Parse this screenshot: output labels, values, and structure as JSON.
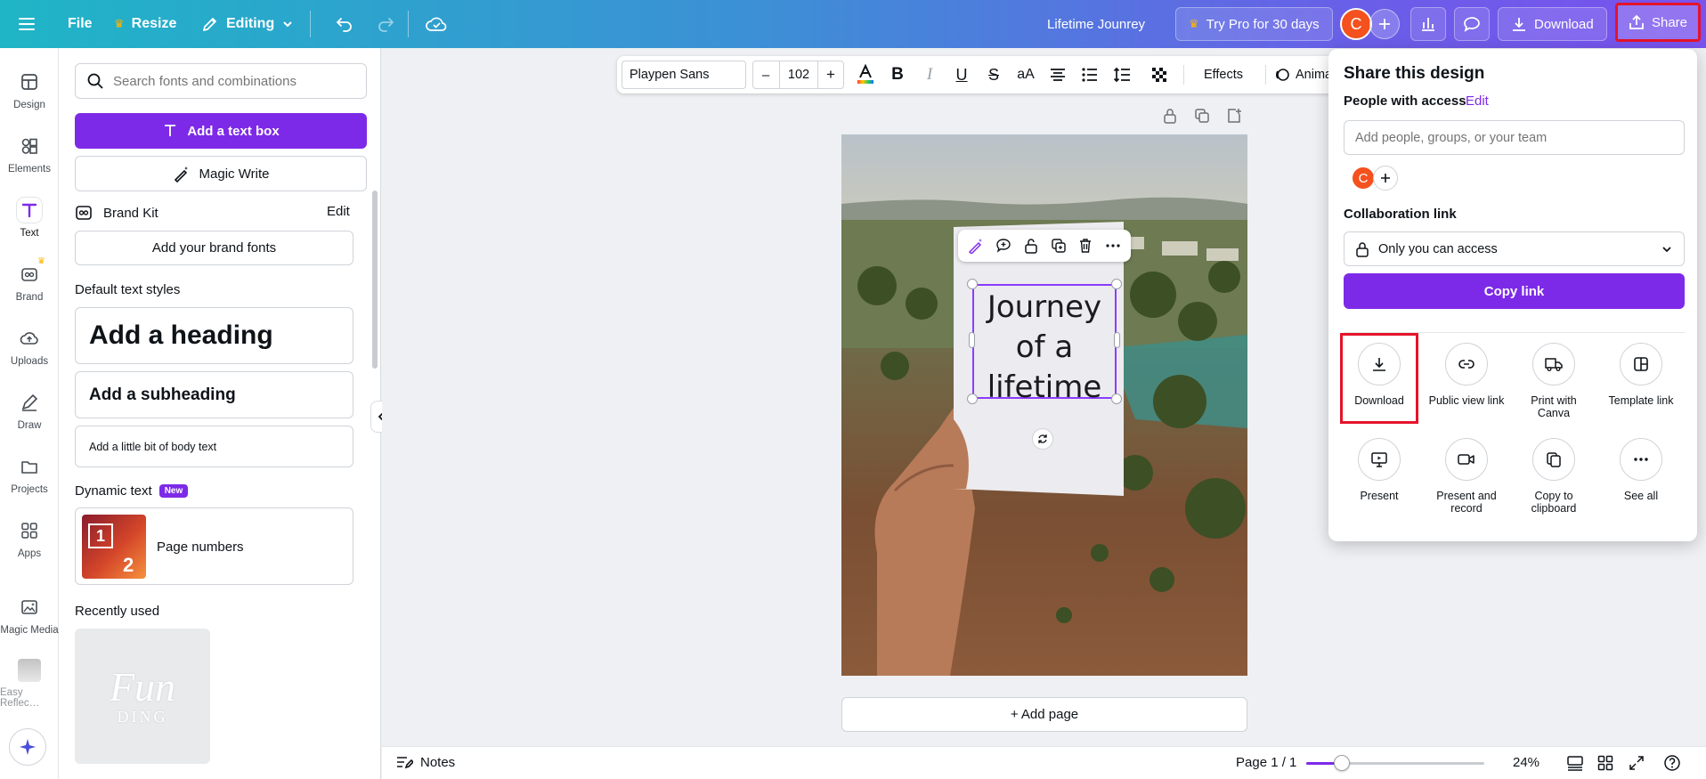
{
  "topbar": {
    "file_label": "File",
    "resize_label": "Resize",
    "editing_label": "Editing",
    "design_title": "Lifetime Jounrey",
    "try_pro_label": "Try Pro for 30 days",
    "avatar_letter": "C",
    "download_label": "Download",
    "share_label": "Share"
  },
  "rail": {
    "items": [
      {
        "label": "Design",
        "icon": "layout-icon"
      },
      {
        "label": "Elements",
        "icon": "shapes-icon"
      },
      {
        "label": "Text",
        "icon": "text-icon"
      },
      {
        "label": "Brand",
        "icon": "brand-icon"
      },
      {
        "label": "Uploads",
        "icon": "cloud-upload-icon"
      },
      {
        "label": "Draw",
        "icon": "pen-icon"
      },
      {
        "label": "Projects",
        "icon": "folder-icon"
      },
      {
        "label": "Apps",
        "icon": "apps-icon"
      },
      {
        "label": "Magic Media",
        "icon": "magic-media-icon"
      },
      {
        "label": "Easy Reflec…",
        "icon": "easy-reflection-icon"
      }
    ]
  },
  "panel": {
    "search_placeholder": "Search fonts and combinations",
    "add_text_box": "Add a text box",
    "magic_write": "Magic Write",
    "brand_kit": "Brand Kit",
    "brand_edit": "Edit",
    "add_brand_fonts": "Add your brand fonts",
    "default_styles": "Default text styles",
    "heading": "Add a heading",
    "subheading": "Add a subheading",
    "body": "Add a little bit of body text",
    "dynamic_text": "Dynamic text",
    "new_badge": "New",
    "page_numbers": "Page numbers",
    "page_num_thumb_1": "1",
    "page_num_thumb_2": "2",
    "recently_used": "Recently used",
    "recent_thumb_text_1": "Fun",
    "recent_thumb_text_2": "DING"
  },
  "toolbar": {
    "font": "Playpen Sans",
    "minus": "–",
    "font_size": "102",
    "plus": "+",
    "effects": "Effects",
    "animate": "Animate"
  },
  "canvas": {
    "text_line1": "Journey",
    "text_line2": "of a",
    "text_line3": "lifetime",
    "add_page": "+ Add page"
  },
  "share": {
    "title": "Share this design",
    "people_with_access": "People with access",
    "edit": "Edit",
    "add_people_placeholder": "Add people, groups, or your team",
    "avatar_letter": "C",
    "collab_link": "Collaboration link",
    "access_value": "Only you can access",
    "copy_link": "Copy link",
    "options": [
      {
        "label": "Download",
        "icon": "download-icon"
      },
      {
        "label": "Public view link",
        "icon": "link-icon"
      },
      {
        "label": "Print with Canva",
        "icon": "truck-icon"
      },
      {
        "label": "Template link",
        "icon": "template-icon"
      },
      {
        "label": "Present",
        "icon": "present-icon"
      },
      {
        "label": "Present and record",
        "icon": "camera-icon"
      },
      {
        "label": "Copy to clipboard",
        "icon": "copy-icon"
      },
      {
        "label": "See all",
        "icon": "more-icon"
      }
    ]
  },
  "bottombar": {
    "notes": "Notes",
    "page_indicator": "Page 1 / 1",
    "zoom": "24%",
    "zoom_fraction": 0.2
  },
  "colors": {
    "accent_purple": "#7d2ae8",
    "highlight_red": "#e5132a",
    "avatar_orange": "#f4511e"
  }
}
